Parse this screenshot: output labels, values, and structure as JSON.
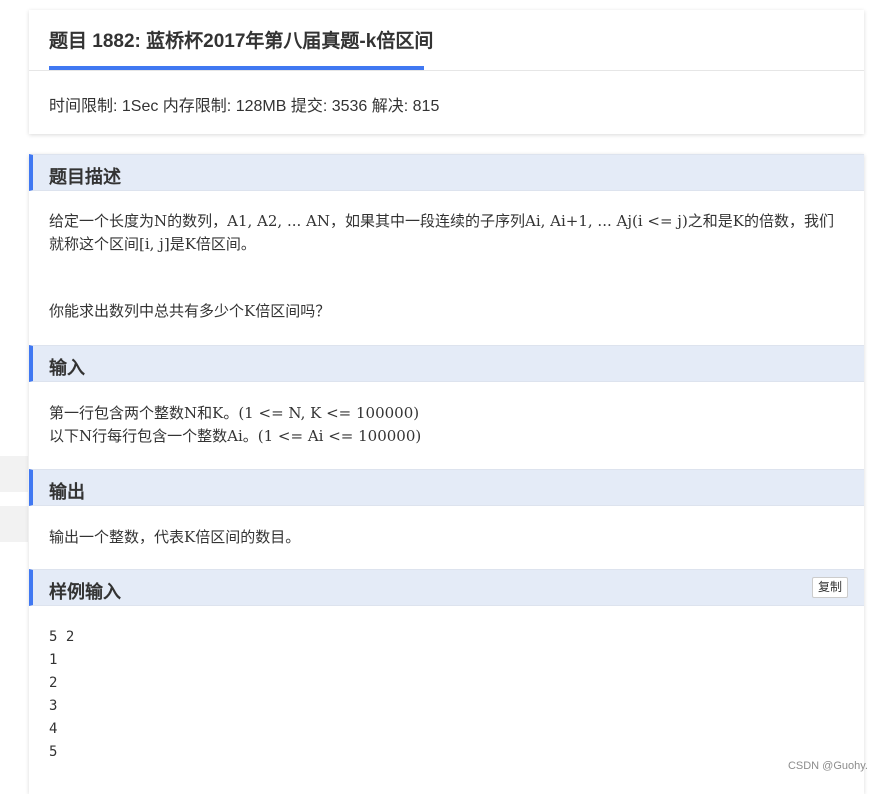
{
  "problem": {
    "title": "题目 1882: 蓝桥杯2017年第八届真题-k倍区间",
    "stats": "时间限制: 1Sec 内存限制: 128MB 提交: 3536 解决: 815"
  },
  "sections": {
    "description": {
      "heading": "题目描述",
      "paragraphs": [
        "给定一个长度为N的数列，A1, A2, ... AN，如果其中一段连续的子序列Ai, Ai+1, ... Aj(i <= j)之和是K的倍数，我们就称这个区间[i, j]是K倍区间。",
        "你能求出数列中总共有多少个K倍区间吗？"
      ]
    },
    "input": {
      "heading": "输入",
      "lines": [
        "第一行包含两个整数N和K。(1 <= N, K <= 100000)",
        "以下N行每行包含一个整数Ai。(1 <= Ai <= 100000)"
      ]
    },
    "output": {
      "heading": "输出",
      "text": "输出一个整数，代表K倍区间的数目。"
    },
    "sample_input": {
      "heading": "样例输入",
      "copy_label": "复制",
      "lines": [
        "5 2",
        "1",
        "2",
        "3",
        "4",
        "5"
      ]
    }
  },
  "watermark": "CSDN @Guohy.",
  "colors": {
    "accent": "#4078f2",
    "section_bg": "#e4ebf7"
  }
}
